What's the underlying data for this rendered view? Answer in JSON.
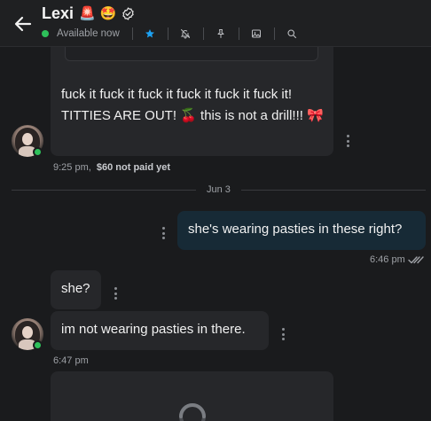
{
  "header": {
    "name": "Lexi",
    "name_emojis": "🚨 🤩",
    "status": "Available now"
  },
  "messages": {
    "m1_text": "fuck it fuck it fuck it fuck it fuck it fuck it! TITTIES ARE OUT! 🍒 this is not a drill!!! 🎀",
    "m1_time": "9:25 pm,",
    "m1_price": "$60 not paid yet",
    "day": "Jun 3",
    "m2_text": "she's wearing pasties in these right?",
    "m2_time": "6:46 pm",
    "m3_text": "she?",
    "m4_text": "im not wearing pasties in there.",
    "m4_time": "6:47 pm"
  },
  "colors": {
    "accent": "#1da1f2",
    "online": "#2ec05a",
    "incoming_bubble": "#26272a",
    "outgoing_bubble": "#172a36"
  }
}
